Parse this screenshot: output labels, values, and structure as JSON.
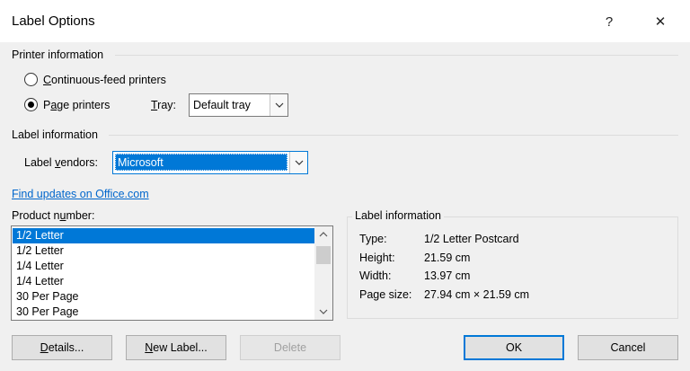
{
  "dialog": {
    "title": "Label Options",
    "help_glyph": "?",
    "close_glyph": "✕"
  },
  "printer": {
    "section_label": "Printer information",
    "continuous_label_u": "C",
    "continuous_label_rest": "ontinuous-feed printers",
    "page_label_pre": "P",
    "page_label_u": "a",
    "page_label_rest": "ge printers",
    "selected": "page",
    "tray_label_u": "T",
    "tray_label_rest": "ray:",
    "tray_value": "Default tray"
  },
  "label_info": {
    "section_label": "Label information",
    "vendors_label_pre": "Label ",
    "vendors_label_u": "v",
    "vendors_label_rest": "endors:",
    "vendor_value": "Microsoft",
    "find_updates_link": "Find updates on Office.com"
  },
  "product": {
    "label_pre": "Product n",
    "label_u": "u",
    "label_rest": "mber:",
    "items": [
      "1/2 Letter",
      "1/2 Letter",
      "1/4 Letter",
      "1/4 Letter",
      "30 Per Page",
      "30 Per Page"
    ],
    "selected_index": 0
  },
  "details_group": {
    "title": "Label information",
    "rows": [
      {
        "key": "Type:",
        "value": "1/2 Letter Postcard"
      },
      {
        "key": "Height:",
        "value": "21.59 cm"
      },
      {
        "key": "Width:",
        "value": "13.97 cm"
      },
      {
        "key": "Page size:",
        "value": "27.94 cm × 21.59 cm"
      }
    ]
  },
  "buttons": {
    "details_u": "D",
    "details_rest": "etails...",
    "new_label_u": "N",
    "new_label_rest": "ew Label...",
    "delete": "Delete",
    "ok": "OK",
    "cancel": "Cancel"
  },
  "colors": {
    "accent": "#0078d7",
    "link": "#0066cc",
    "background": "#f0f0f0"
  },
  "icons": {
    "help": "question-mark-icon",
    "close": "close-icon",
    "dropdown": "chevron-down-icon",
    "scroll_up": "chevron-up-icon",
    "scroll_down": "chevron-down-icon"
  }
}
